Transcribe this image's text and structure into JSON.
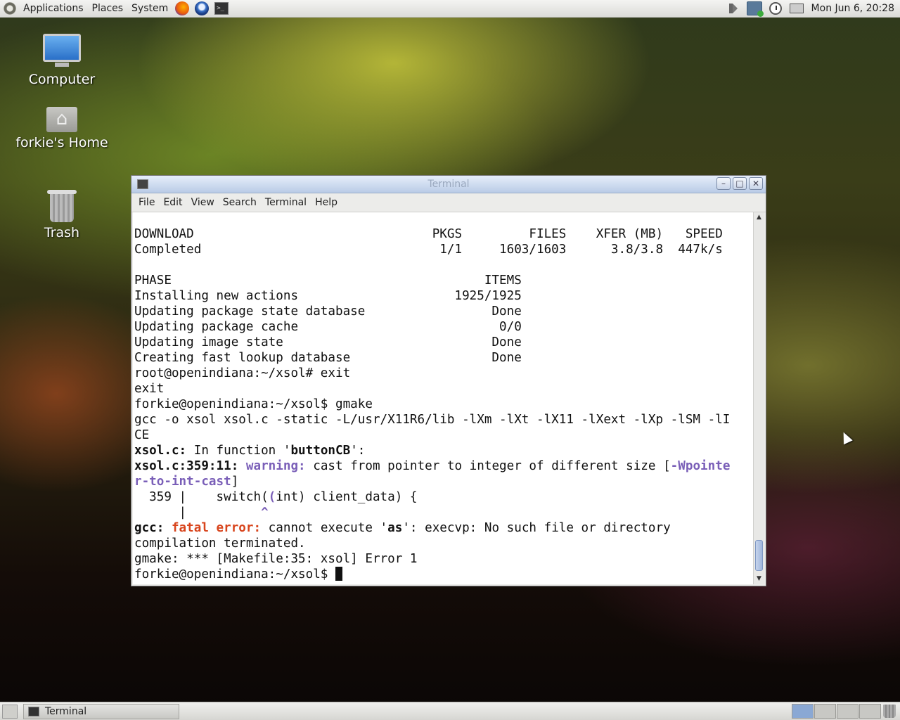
{
  "top_panel": {
    "menus": [
      "Applications",
      "Places",
      "System"
    ],
    "launchers": [
      "firefox-icon",
      "thunderbird-icon",
      "terminal-icon"
    ],
    "clock": "Mon Jun  6, 20:28"
  },
  "desktop": {
    "icons": [
      {
        "label": "Computer",
        "icon": "computer-icon"
      },
      {
        "label": "forkie's Home",
        "icon": "home-folder-icon"
      },
      {
        "label": "Trash",
        "icon": "trash-icon"
      }
    ]
  },
  "window": {
    "title": "Terminal",
    "menu": [
      "File",
      "Edit",
      "View",
      "Search",
      "Terminal",
      "Help"
    ],
    "buttons": {
      "minimize": "–",
      "maximize": "□",
      "close": "✕"
    }
  },
  "terminal": {
    "lines": [
      "DOWNLOAD                                PKGS         FILES    XFER (MB)   SPEED",
      "Completed                                1/1     1603/1603      3.8/3.8  447k/s",
      "",
      "PHASE                                          ITEMS",
      "Installing new actions                     1925/1925",
      "Updating package state database                 Done",
      "Updating package cache                           0/0",
      "Updating image state                            Done",
      "Creating fast lookup database                   Done",
      "root@openindiana:~/xsol# exit",
      "exit",
      "forkie@openindiana:~/xsol$ gmake",
      "gcc -o xsol xsol.c -static -L/usr/X11R6/lib -lXm -lXt -lX11 -lXext -lXp -lSM -lI",
      "CE"
    ],
    "fn_line": {
      "file": "xsol.c:",
      "text": " In function '",
      "fn": "buttonCB",
      "end": "':"
    },
    "warn_line": {
      "loc": "xsol.c:359:11:",
      "label": " warning:",
      "text": " cast from pointer to integer of different size [",
      "flag": "-Wpointe"
    },
    "warn_line2": {
      "flag": "r-to-int-cast",
      "end": "]"
    },
    "code_line": {
      "prefix": "  359 |    switch(",
      "paren": "(",
      "rest": "int) client_data) {"
    },
    "caret_line": {
      "bar": "      |",
      "pad": "          ",
      "caret": "^"
    },
    "error_line": {
      "tool": "gcc:",
      "label": " fatal error:",
      "text": " cannot execute '",
      "name": "as",
      "end": "': execvp: No such file or directory"
    },
    "tail_lines": [
      "compilation terminated.",
      "gmake: *** [Makefile:35: xsol] Error 1"
    ],
    "prompt": "forkie@openindiana:~/xsol$ "
  },
  "bottom_panel": {
    "task": "Terminal",
    "workspaces": 4
  }
}
